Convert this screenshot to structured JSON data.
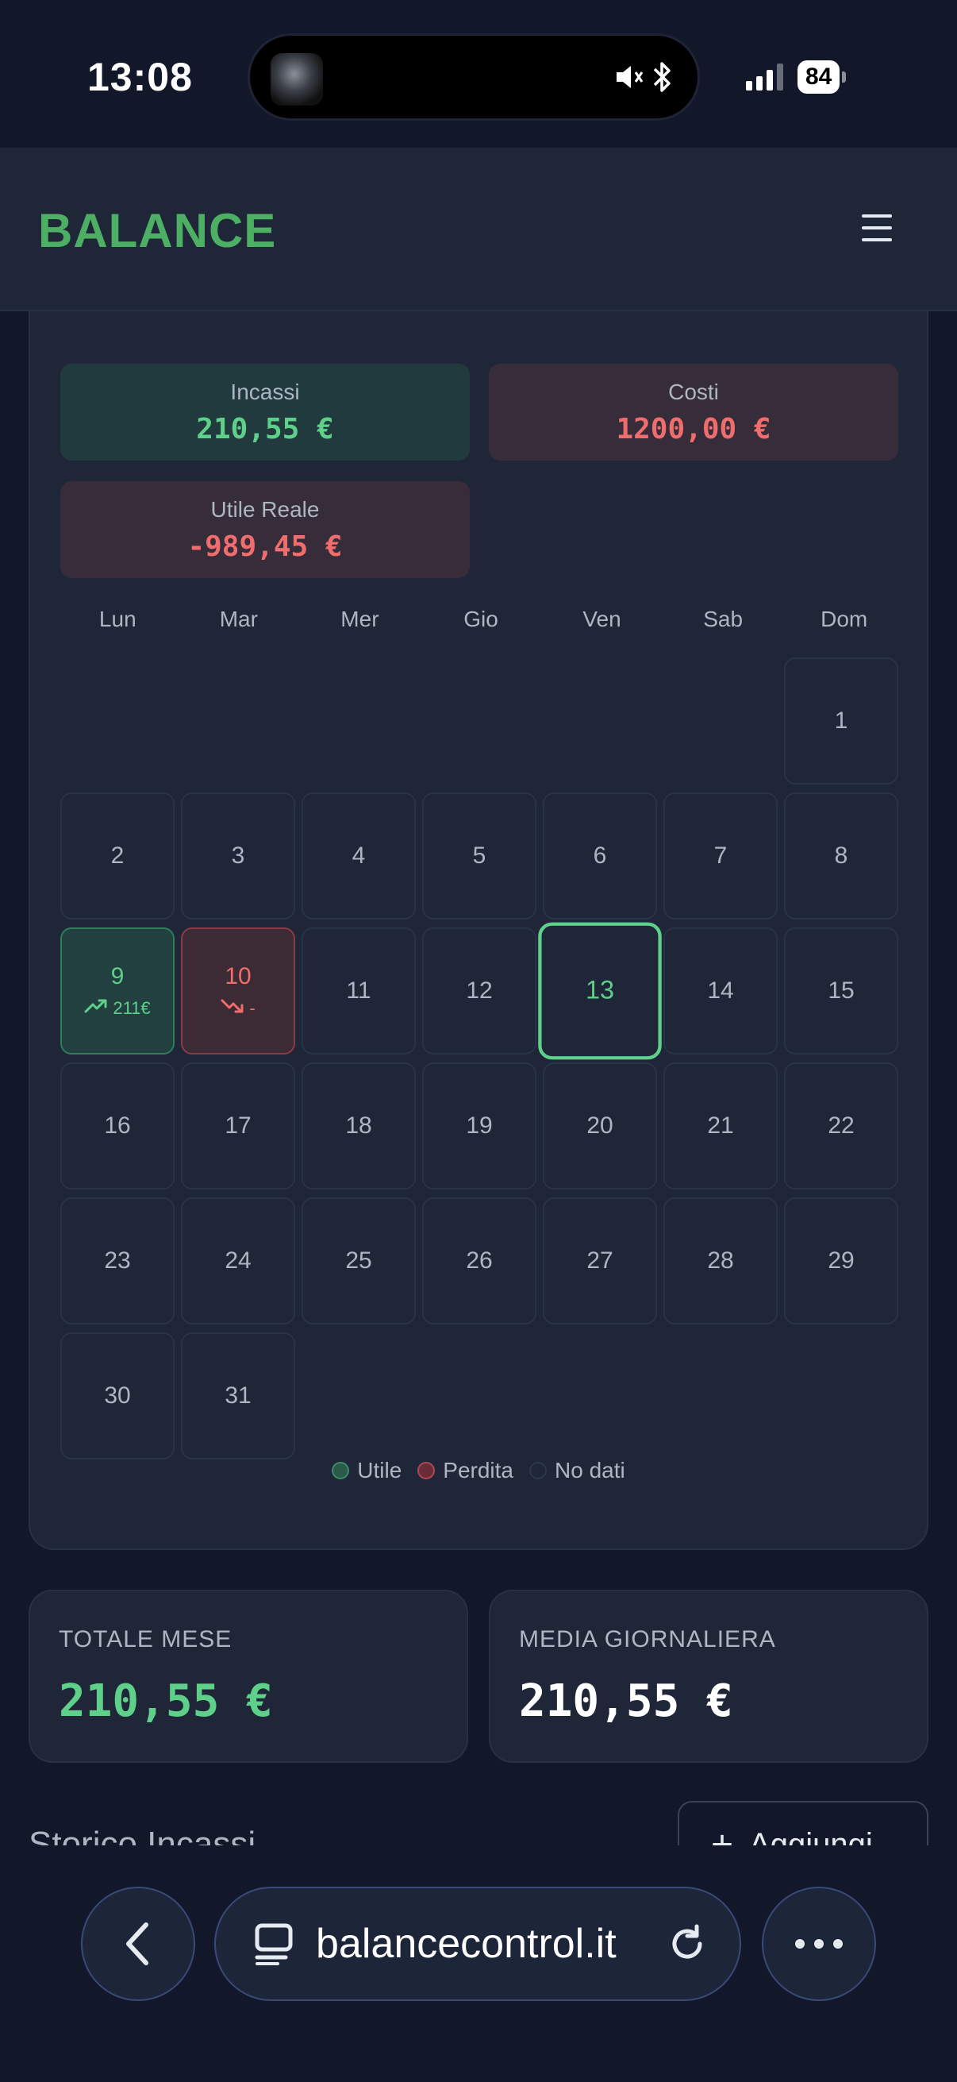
{
  "status": {
    "time": "13:08",
    "battery": "84"
  },
  "header": {
    "brand": "BALANCE"
  },
  "stats": {
    "incassi_label": "Incassi",
    "incassi_value": "210,55 €",
    "costi_label": "Costi",
    "costi_value": "1200,00 €",
    "utile_label": "Utile Reale",
    "utile_value": "-989,45 €"
  },
  "calendar": {
    "weekdays": [
      "Lun",
      "Mar",
      "Mer",
      "Gio",
      "Ven",
      "Sab",
      "Dom"
    ],
    "leading_blanks": 6,
    "days": [
      "1",
      "2",
      "3",
      "4",
      "5",
      "6",
      "7",
      "8",
      "9",
      "10",
      "11",
      "12",
      "13",
      "14",
      "15",
      "16",
      "17",
      "18",
      "19",
      "20",
      "21",
      "22",
      "23",
      "24",
      "25",
      "26",
      "27",
      "28",
      "29",
      "30",
      "31"
    ],
    "profit_day": {
      "day": "9",
      "amount": "211€"
    },
    "loss_day": {
      "day": "10",
      "amount": "-"
    },
    "today": "13",
    "colors": {
      "profit": "#5fd08a",
      "loss": "#ef6d6d"
    }
  },
  "legend": {
    "profit": "Utile",
    "loss": "Perdita",
    "none": "No dati"
  },
  "summary": {
    "total_label": "TOTALE MESE",
    "total_value": "210,55 €",
    "avg_label": "MEDIA GIORNALIERA",
    "avg_value": "210,55 €"
  },
  "history": {
    "title": "Storico Incassi",
    "add_label": "Aggiungi"
  },
  "browser": {
    "url": "balancecontrol.it"
  }
}
